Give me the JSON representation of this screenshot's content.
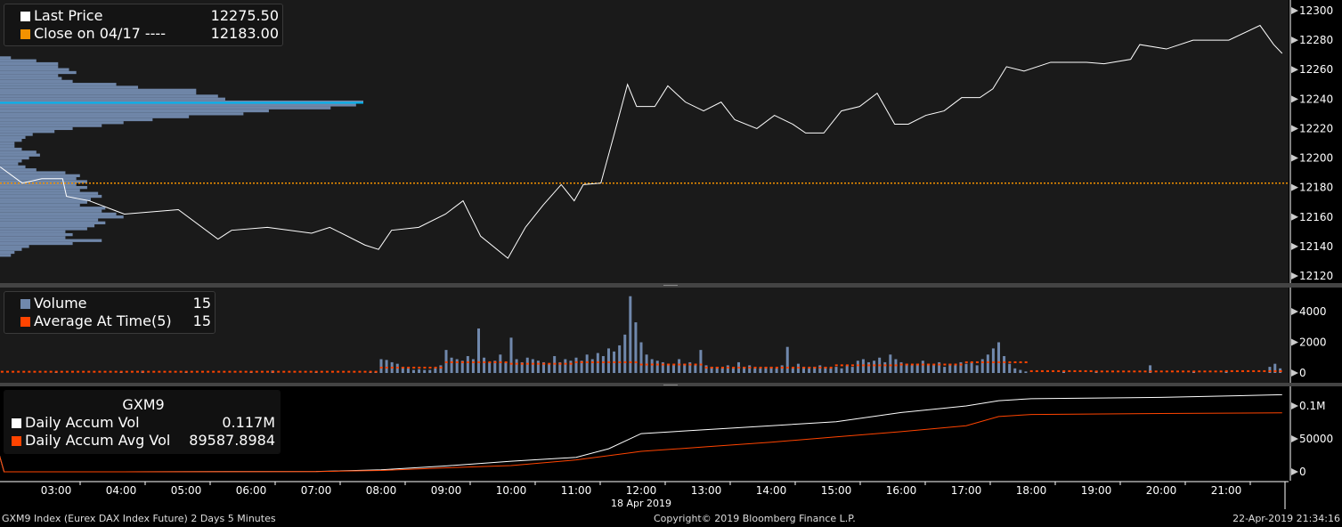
{
  "chart_data": [
    {
      "type": "line",
      "panel": "price",
      "ylim": [
        12115,
        12305
      ],
      "yticks": [
        12120,
        12140,
        12160,
        12180,
        12200,
        12220,
        12240,
        12260,
        12280,
        12300
      ],
      "legend": [
        {
          "label": "Last Price",
          "value": "12275.50",
          "color": "#ffffff"
        },
        {
          "label": "Close on 04/17 ----",
          "value": "12183.00",
          "color": "#f39200"
        }
      ],
      "close_level": 12183.0,
      "poc_level": 12237.5,
      "series": [
        {
          "name": "Last Price",
          "color": "#ffffff",
          "points": [
            [
              2.14,
              12194
            ],
            [
              2.48,
              12183
            ],
            [
              2.78,
              12186
            ],
            [
              3.1,
              12186
            ],
            [
              3.16,
              12174
            ],
            [
              3.51,
              12171
            ],
            [
              4.05,
              12162
            ],
            [
              4.88,
              12165
            ],
            [
              5.49,
              12145
            ],
            [
              5.7,
              12151
            ],
            [
              6.25,
              12153
            ],
            [
              6.93,
              12149
            ],
            [
              7.21,
              12153
            ],
            [
              7.75,
              12141
            ],
            [
              7.96,
              12138
            ],
            [
              8.16,
              12151
            ],
            [
              8.58,
              12153
            ],
            [
              8.99,
              12162
            ],
            [
              9.26,
              12171
            ],
            [
              9.53,
              12147
            ],
            [
              9.95,
              12132
            ],
            [
              10.22,
              12153
            ],
            [
              10.49,
              12168
            ],
            [
              10.77,
              12182
            ],
            [
              10.97,
              12171
            ],
            [
              11.11,
              12182
            ],
            [
              11.38,
              12183
            ],
            [
              11.59,
              12217
            ],
            [
              11.79,
              12250
            ],
            [
              11.93,
              12235
            ],
            [
              12.21,
              12235
            ],
            [
              12.41,
              12249
            ],
            [
              12.68,
              12238
            ],
            [
              12.96,
              12232
            ],
            [
              13.23,
              12238
            ],
            [
              13.44,
              12226
            ],
            [
              13.78,
              12220
            ],
            [
              14.05,
              12229
            ],
            [
              14.33,
              12223
            ],
            [
              14.53,
              12217
            ],
            [
              14.81,
              12217
            ],
            [
              15.08,
              12232
            ],
            [
              15.36,
              12235
            ],
            [
              15.63,
              12244
            ],
            [
              15.9,
              12223
            ],
            [
              16.11,
              12223
            ],
            [
              16.38,
              12229
            ],
            [
              16.66,
              12232
            ],
            [
              16.93,
              12241
            ],
            [
              17.21,
              12241
            ],
            [
              17.41,
              12247
            ],
            [
              17.62,
              12262
            ],
            [
              17.89,
              12259
            ],
            [
              18.3,
              12265
            ],
            [
              18.85,
              12265
            ],
            [
              19.12,
              12264
            ],
            [
              19.53,
              12267
            ],
            [
              19.67,
              12277
            ],
            [
              20.08,
              12274
            ],
            [
              20.49,
              12280
            ],
            [
              21.04,
              12280
            ],
            [
              21.52,
              12290
            ],
            [
              21.73,
              12277
            ],
            [
              21.86,
              12271
            ]
          ]
        }
      ],
      "volume_profile": {
        "color": "#6f86a8",
        "levels": [
          [
            12268,
            3
          ],
          [
            12266,
            10
          ],
          [
            12264,
            16
          ],
          [
            12262,
            16
          ],
          [
            12260,
            19
          ],
          [
            12258,
            21
          ],
          [
            12256,
            16
          ],
          [
            12254,
            17
          ],
          [
            12252,
            20
          ],
          [
            12250,
            32
          ],
          [
            12248,
            38
          ],
          [
            12246,
            54
          ],
          [
            12244,
            54
          ],
          [
            12242,
            60
          ],
          [
            12240,
            62
          ],
          [
            12238,
            100
          ],
          [
            12236,
            98
          ],
          [
            12234,
            91
          ],
          [
            12232,
            74
          ],
          [
            12230,
            67
          ],
          [
            12228,
            52
          ],
          [
            12226,
            42
          ],
          [
            12224,
            34
          ],
          [
            12222,
            28
          ],
          [
            12220,
            20
          ],
          [
            12218,
            15
          ],
          [
            12216,
            9
          ],
          [
            12214,
            7
          ],
          [
            12212,
            6
          ],
          [
            12210,
            4
          ],
          [
            12208,
            4
          ],
          [
            12206,
            6
          ],
          [
            12204,
            10
          ],
          [
            12202,
            11
          ],
          [
            12200,
            8
          ],
          [
            12198,
            6
          ],
          [
            12196,
            5
          ],
          [
            12194,
            7
          ],
          [
            12192,
            10
          ],
          [
            12190,
            18
          ],
          [
            12188,
            22
          ],
          [
            12186,
            21
          ],
          [
            12184,
            24
          ],
          [
            12182,
            21
          ],
          [
            12180,
            24
          ],
          [
            12178,
            22
          ],
          [
            12176,
            27
          ],
          [
            12174,
            28
          ],
          [
            12172,
            25
          ],
          [
            12170,
            24
          ],
          [
            12168,
            22
          ],
          [
            12166,
            29
          ],
          [
            12164,
            28
          ],
          [
            12162,
            32
          ],
          [
            12160,
            34
          ],
          [
            12158,
            27
          ],
          [
            12156,
            29
          ],
          [
            12154,
            26
          ],
          [
            12152,
            24
          ],
          [
            12150,
            18
          ],
          [
            12148,
            20
          ],
          [
            12146,
            18
          ],
          [
            12144,
            28
          ],
          [
            12142,
            20
          ],
          [
            12140,
            8
          ],
          [
            12138,
            6
          ],
          [
            12136,
            4
          ],
          [
            12134,
            3
          ]
        ]
      }
    },
    {
      "type": "bar",
      "panel": "volume",
      "ylim": [
        0,
        5300
      ],
      "yticks": [
        0,
        2000,
        4000
      ],
      "legend": [
        {
          "label": "Volume",
          "value": "15",
          "color": "#7088ac"
        },
        {
          "label": "Average At Time(5)",
          "value": "15",
          "color": "#ff4400"
        }
      ],
      "bar_interval_minutes": 5,
      "session_start_hour": 7.8333,
      "session_volumes": [
        50,
        80,
        900,
        850,
        700,
        600,
        400,
        300,
        200,
        250,
        200,
        200,
        300,
        500,
        1500,
        1000,
        900,
        800,
        1100,
        900,
        2900,
        1000,
        700,
        800,
        1200,
        700,
        2300,
        900,
        700,
        1000,
        900,
        800,
        700,
        600,
        1100,
        700,
        900,
        800,
        1000,
        800,
        1200,
        900,
        1300,
        1100,
        1600,
        1400,
        1800,
        2500,
        5000,
        3300,
        2000,
        1200,
        900,
        800,
        700,
        600,
        500,
        900,
        600,
        700,
        500,
        1500,
        500,
        400,
        400,
        300,
        500,
        300,
        700,
        400,
        500,
        300,
        300,
        400,
        400,
        300,
        500,
        1700,
        300,
        600,
        400,
        300,
        400,
        500,
        400,
        300,
        400,
        300,
        500,
        400,
        800,
        900,
        700,
        800,
        1000,
        700,
        1200,
        900,
        700,
        600,
        500,
        600,
        800,
        600,
        500,
        700,
        400,
        600,
        500,
        700,
        600,
        700,
        500,
        900,
        1200,
        1600,
        2000,
        1100,
        600,
        300,
        200,
        100
      ],
      "offhours_volumes": [
        [
          3.0,
          60
        ],
        [
          4.0,
          60
        ],
        [
          4.33,
          150
        ],
        [
          5.0,
          80
        ],
        [
          6.0,
          90
        ],
        [
          6.33,
          160
        ],
        [
          7.0,
          70
        ],
        [
          18.5,
          100
        ],
        [
          19.0,
          120
        ],
        [
          19.83,
          500
        ],
        [
          20.5,
          100
        ],
        [
          21.0,
          120
        ],
        [
          21.67,
          400
        ],
        [
          21.75,
          600
        ],
        [
          21.83,
          300
        ]
      ],
      "avg_by_hour": {
        "2": 80,
        "3": 80,
        "4": 80,
        "5": 80,
        "6": 80,
        "7": 80,
        "8": 350,
        "9": 700,
        "10": 600,
        "11": 700,
        "12": 550,
        "13": 350,
        "14": 350,
        "15": 500,
        "16": 550,
        "17": 700,
        "18": 120,
        "19": 100,
        "20": 100,
        "21": 120
      }
    },
    {
      "type": "line",
      "panel": "accum",
      "title": "GXM9",
      "ylim": [
        -5000,
        125000
      ],
      "yticks": [
        0,
        50000,
        100000
      ],
      "ytick_labels": [
        "0",
        "50000",
        "0.1M"
      ],
      "legend": [
        {
          "label": "Daily Accum Vol",
          "value": "0.117M",
          "color": "#ffffff"
        },
        {
          "label": "Daily Accum Avg Vol",
          "value": "89587.8984",
          "color": "#ff4400"
        }
      ],
      "series": [
        {
          "name": "Daily Accum Vol",
          "color": "#ffffff",
          "points": [
            [
              2.1,
              35000
            ],
            [
              2.2,
              0
            ],
            [
              4,
              0
            ],
            [
              7,
              500
            ],
            [
              8,
              3000
            ],
            [
              9,
              9000
            ],
            [
              10,
              16000
            ],
            [
              11,
              22000
            ],
            [
              11.5,
              35000
            ],
            [
              12,
              58000
            ],
            [
              13,
              64000
            ],
            [
              14,
              70000
            ],
            [
              15,
              76000
            ],
            [
              16,
              90000
            ],
            [
              17,
              100000
            ],
            [
              17.5,
              108000
            ],
            [
              18,
              111000
            ],
            [
              20,
              113000
            ],
            [
              21.86,
              117000
            ]
          ]
        },
        {
          "name": "Daily Accum Avg Vol",
          "color": "#ff4400",
          "points": [
            [
              2.1,
              35000
            ],
            [
              2.2,
              0
            ],
            [
              4,
              0
            ],
            [
              7,
              400
            ],
            [
              8,
              2000
            ],
            [
              9,
              6000
            ],
            [
              10,
              9500
            ],
            [
              11,
              18000
            ],
            [
              12,
              31000
            ],
            [
              13,
              38000
            ],
            [
              14,
              45000
            ],
            [
              15,
              53000
            ],
            [
              16,
              61000
            ],
            [
              17,
              70000
            ],
            [
              17.5,
              84000
            ],
            [
              18,
              87000
            ],
            [
              20,
              88500
            ],
            [
              21.86,
              89588
            ]
          ]
        }
      ]
    }
  ],
  "xaxis": {
    "ticks": [
      {
        "hour": 3,
        "label": "03:00"
      },
      {
        "hour": 4,
        "label": "04:00"
      },
      {
        "hour": 5,
        "label": "05:00"
      },
      {
        "hour": 6,
        "label": "06:00"
      },
      {
        "hour": 7,
        "label": "07:00"
      },
      {
        "hour": 8,
        "label": "08:00"
      },
      {
        "hour": 9,
        "label": "09:00"
      },
      {
        "hour": 10,
        "label": "10:00"
      },
      {
        "hour": 11,
        "label": "11:00"
      },
      {
        "hour": 12,
        "label": "12:00"
      },
      {
        "hour": 13,
        "label": "13:00"
      },
      {
        "hour": 14,
        "label": "14:00"
      },
      {
        "hour": 15,
        "label": "15:00"
      },
      {
        "hour": 16,
        "label": "16:00"
      },
      {
        "hour": 17,
        "label": "17:00"
      },
      {
        "hour": 18,
        "label": "18:00"
      },
      {
        "hour": 19,
        "label": "19:00"
      },
      {
        "hour": 20,
        "label": "20:00"
      },
      {
        "hour": 21,
        "label": "21:00"
      }
    ],
    "date_label": "18 Apr 2019"
  },
  "footer": {
    "security": "GXM9 Index (Eurex DAX Index Future) 2 Days 5 Minutes",
    "copyright": "Copyright© 2019 Bloomberg Finance L.P.",
    "timestamp": "22-Apr-2019 21:34:16"
  }
}
